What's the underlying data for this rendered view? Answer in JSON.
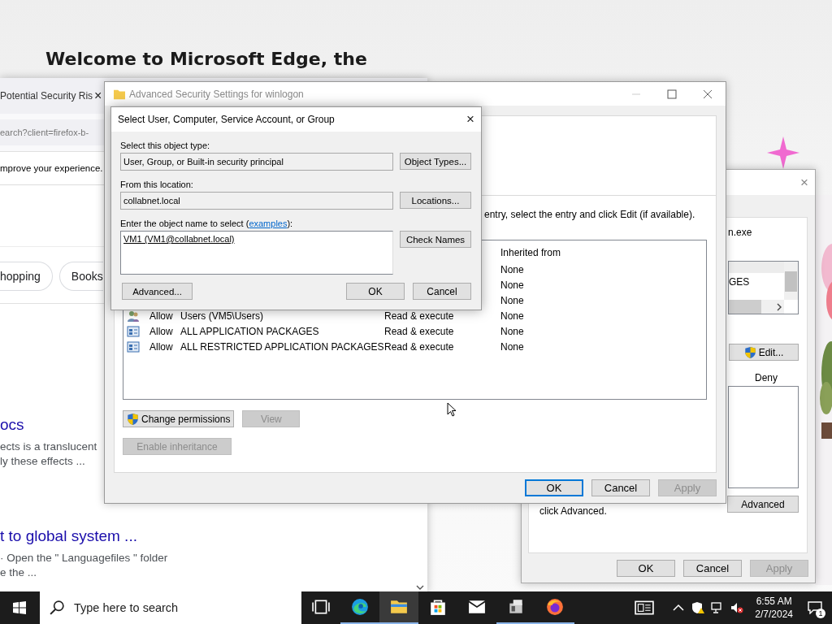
{
  "background_page": {
    "heading": "Welcome to Microsoft Edge, the"
  },
  "browser_window": {
    "tab_title": "Potential Security Ris",
    "tab_close": "×",
    "address": "earch?client=firefox-b-",
    "notice": "mprove your experience.",
    "chips": [
      {
        "label": "hopping"
      },
      {
        "label": "Books"
      }
    ],
    "results": [
      {
        "title": "ocs",
        "snippet_lines": [
          "ects is a translucent",
          "ly these effects ..."
        ]
      },
      {
        "title": "t to global system ...",
        "snippet_lines": [
          "· Open the \" Languagefiles \" folder",
          "e the ..."
        ]
      }
    ]
  },
  "properties_window": {
    "close": "×",
    "file_name": "n.exe",
    "group_list": [
      "GES"
    ],
    "edit_button": "Edit...",
    "permission_column": "Deny",
    "note": "click Advanced.",
    "advanced_button": "Advanced",
    "buttons": [
      {
        "label": "OK",
        "disabled": false
      },
      {
        "label": "Cancel",
        "disabled": false
      },
      {
        "label": "Apply",
        "disabled": true
      }
    ]
  },
  "advanced_window": {
    "title": "Advanced Security Settings for winlogon",
    "instruction": "entry, select the entry and click Edit (if available).",
    "column": "Inherited from",
    "entries": [
      {
        "inherited": "None"
      },
      {
        "inherited": "None"
      },
      {
        "inherited": "None"
      },
      {
        "kind": "users",
        "type": "Allow",
        "principal": "Users (VM5\\Users)",
        "access": "Read & execute",
        "inherited": "None"
      },
      {
        "kind": "package",
        "type": "Allow",
        "principal": "ALL APPLICATION PACKAGES",
        "access": "Read & execute",
        "inherited": "None"
      },
      {
        "kind": "package",
        "type": "Allow",
        "principal": "ALL RESTRICTED APPLICATION PACKAGES",
        "access": "Read & execute",
        "inherited": "None"
      }
    ],
    "actions": [
      {
        "label": "Change permissions",
        "shield": true,
        "disabled": false
      },
      {
        "label": "View",
        "shield": false,
        "disabled": true
      }
    ],
    "inheritance_button": {
      "label": "Enable inheritance",
      "disabled": true
    },
    "buttons": [
      {
        "label": "OK",
        "default": true,
        "disabled": false
      },
      {
        "label": "Cancel",
        "default": false,
        "disabled": false
      },
      {
        "label": "Apply",
        "default": false,
        "disabled": true
      }
    ]
  },
  "select_dialog": {
    "title": "Select User, Computer, Service Account, or Group",
    "close": "×",
    "fields": [
      {
        "label": "Select this object type:",
        "value": "User, Group, or Built-in security principal",
        "button": "Object Types..."
      },
      {
        "label": "From this location:",
        "value": "collabnet.local",
        "button": "Locations..."
      }
    ],
    "name_label_start": "Enter the object name to select (",
    "examples_link": "examples",
    "name_label_end": "):",
    "names": "VM1 (VM1@collabnet.local)",
    "check_button": "Check Names",
    "advanced_button": "Advanced...",
    "buttons": [
      "OK",
      "Cancel"
    ]
  },
  "taskbar": {
    "search_placeholder": "Type here to search",
    "apps": [
      {
        "kind": "taskview",
        "running": false,
        "active": false
      },
      {
        "kind": "edge",
        "running": true,
        "active": false
      },
      {
        "kind": "explorer",
        "running": true,
        "active": true
      },
      {
        "kind": "store",
        "running": false,
        "active": false
      },
      {
        "kind": "mail",
        "running": false,
        "active": false
      },
      {
        "kind": "server",
        "running": true,
        "active": false
      },
      {
        "kind": "firefox",
        "running": true,
        "active": false
      }
    ],
    "time": "6:55 AM",
    "date": "2/7/2024",
    "notification_count": "1"
  }
}
